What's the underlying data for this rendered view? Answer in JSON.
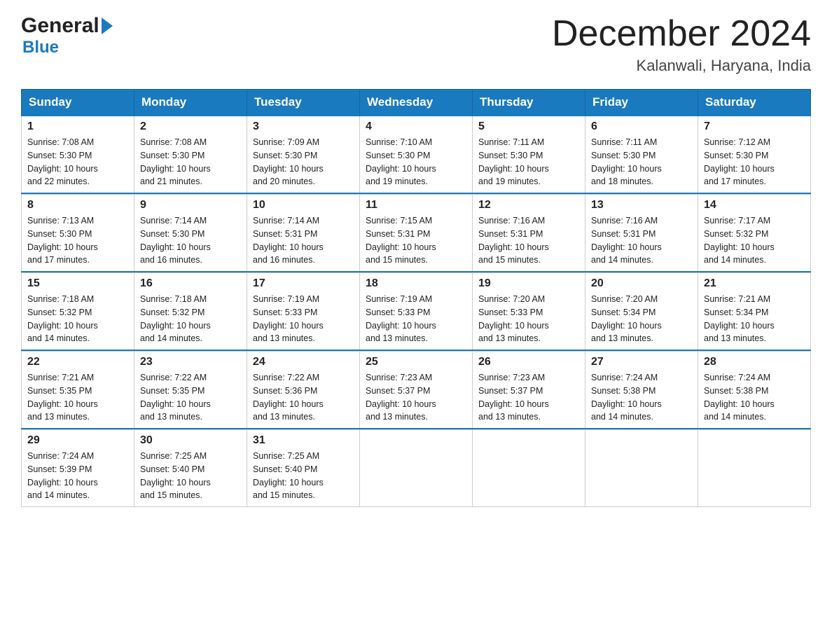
{
  "header": {
    "logo_main": "General",
    "logo_sub": "Blue",
    "month_title": "December 2024",
    "location": "Kalanwali, Haryana, India"
  },
  "days_of_week": [
    "Sunday",
    "Monday",
    "Tuesday",
    "Wednesday",
    "Thursday",
    "Friday",
    "Saturday"
  ],
  "weeks": [
    [
      {
        "day": "1",
        "sunrise": "7:08 AM",
        "sunset": "5:30 PM",
        "daylight": "10 hours and 22 minutes."
      },
      {
        "day": "2",
        "sunrise": "7:08 AM",
        "sunset": "5:30 PM",
        "daylight": "10 hours and 21 minutes."
      },
      {
        "day": "3",
        "sunrise": "7:09 AM",
        "sunset": "5:30 PM",
        "daylight": "10 hours and 20 minutes."
      },
      {
        "day": "4",
        "sunrise": "7:10 AM",
        "sunset": "5:30 PM",
        "daylight": "10 hours and 19 minutes."
      },
      {
        "day": "5",
        "sunrise": "7:11 AM",
        "sunset": "5:30 PM",
        "daylight": "10 hours and 19 minutes."
      },
      {
        "day": "6",
        "sunrise": "7:11 AM",
        "sunset": "5:30 PM",
        "daylight": "10 hours and 18 minutes."
      },
      {
        "day": "7",
        "sunrise": "7:12 AM",
        "sunset": "5:30 PM",
        "daylight": "10 hours and 17 minutes."
      }
    ],
    [
      {
        "day": "8",
        "sunrise": "7:13 AM",
        "sunset": "5:30 PM",
        "daylight": "10 hours and 17 minutes."
      },
      {
        "day": "9",
        "sunrise": "7:14 AM",
        "sunset": "5:30 PM",
        "daylight": "10 hours and 16 minutes."
      },
      {
        "day": "10",
        "sunrise": "7:14 AM",
        "sunset": "5:31 PM",
        "daylight": "10 hours and 16 minutes."
      },
      {
        "day": "11",
        "sunrise": "7:15 AM",
        "sunset": "5:31 PM",
        "daylight": "10 hours and 15 minutes."
      },
      {
        "day": "12",
        "sunrise": "7:16 AM",
        "sunset": "5:31 PM",
        "daylight": "10 hours and 15 minutes."
      },
      {
        "day": "13",
        "sunrise": "7:16 AM",
        "sunset": "5:31 PM",
        "daylight": "10 hours and 14 minutes."
      },
      {
        "day": "14",
        "sunrise": "7:17 AM",
        "sunset": "5:32 PM",
        "daylight": "10 hours and 14 minutes."
      }
    ],
    [
      {
        "day": "15",
        "sunrise": "7:18 AM",
        "sunset": "5:32 PM",
        "daylight": "10 hours and 14 minutes."
      },
      {
        "day": "16",
        "sunrise": "7:18 AM",
        "sunset": "5:32 PM",
        "daylight": "10 hours and 14 minutes."
      },
      {
        "day": "17",
        "sunrise": "7:19 AM",
        "sunset": "5:33 PM",
        "daylight": "10 hours and 13 minutes."
      },
      {
        "day": "18",
        "sunrise": "7:19 AM",
        "sunset": "5:33 PM",
        "daylight": "10 hours and 13 minutes."
      },
      {
        "day": "19",
        "sunrise": "7:20 AM",
        "sunset": "5:33 PM",
        "daylight": "10 hours and 13 minutes."
      },
      {
        "day": "20",
        "sunrise": "7:20 AM",
        "sunset": "5:34 PM",
        "daylight": "10 hours and 13 minutes."
      },
      {
        "day": "21",
        "sunrise": "7:21 AM",
        "sunset": "5:34 PM",
        "daylight": "10 hours and 13 minutes."
      }
    ],
    [
      {
        "day": "22",
        "sunrise": "7:21 AM",
        "sunset": "5:35 PM",
        "daylight": "10 hours and 13 minutes."
      },
      {
        "day": "23",
        "sunrise": "7:22 AM",
        "sunset": "5:35 PM",
        "daylight": "10 hours and 13 minutes."
      },
      {
        "day": "24",
        "sunrise": "7:22 AM",
        "sunset": "5:36 PM",
        "daylight": "10 hours and 13 minutes."
      },
      {
        "day": "25",
        "sunrise": "7:23 AM",
        "sunset": "5:37 PM",
        "daylight": "10 hours and 13 minutes."
      },
      {
        "day": "26",
        "sunrise": "7:23 AM",
        "sunset": "5:37 PM",
        "daylight": "10 hours and 13 minutes."
      },
      {
        "day": "27",
        "sunrise": "7:24 AM",
        "sunset": "5:38 PM",
        "daylight": "10 hours and 14 minutes."
      },
      {
        "day": "28",
        "sunrise": "7:24 AM",
        "sunset": "5:38 PM",
        "daylight": "10 hours and 14 minutes."
      }
    ],
    [
      {
        "day": "29",
        "sunrise": "7:24 AM",
        "sunset": "5:39 PM",
        "daylight": "10 hours and 14 minutes."
      },
      {
        "day": "30",
        "sunrise": "7:25 AM",
        "sunset": "5:40 PM",
        "daylight": "10 hours and 15 minutes."
      },
      {
        "day": "31",
        "sunrise": "7:25 AM",
        "sunset": "5:40 PM",
        "daylight": "10 hours and 15 minutes."
      },
      null,
      null,
      null,
      null
    ]
  ],
  "labels": {
    "sunrise": "Sunrise:",
    "sunset": "Sunset:",
    "daylight": "Daylight:"
  }
}
